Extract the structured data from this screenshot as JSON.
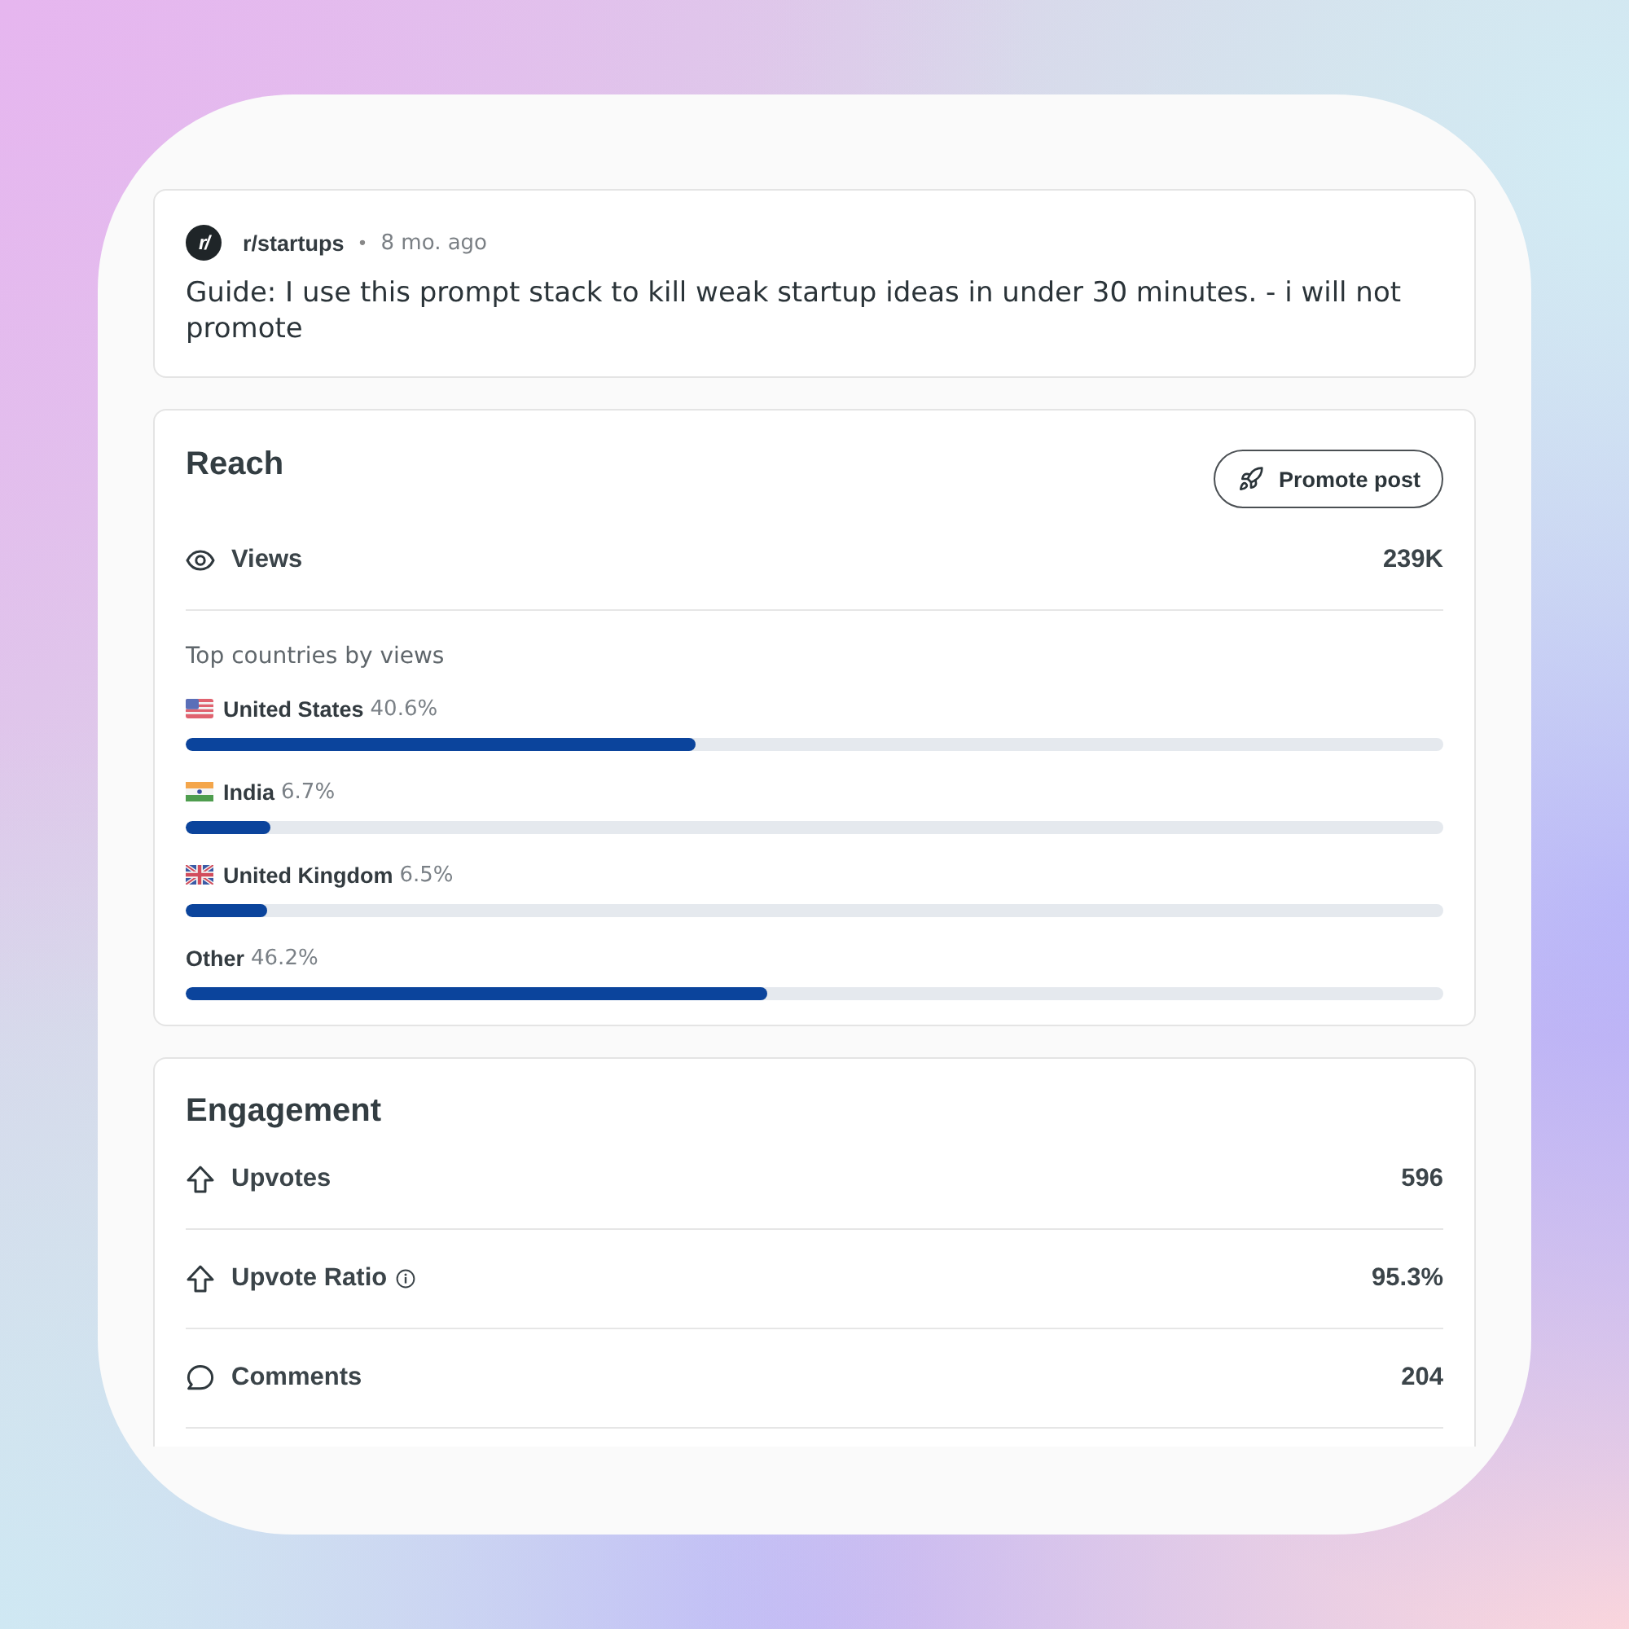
{
  "post": {
    "avatar_text": "r/",
    "subreddit": "r/startups",
    "separator": "•",
    "age": "8 mo. ago",
    "title": "Guide: I use this prompt stack to kill weak startup ideas in under 30 minutes. - i will not promote"
  },
  "reach": {
    "title": "Reach",
    "promote_button": "Promote post",
    "views": {
      "label": "Views",
      "value": "239K"
    },
    "countries_heading": "Top countries by views",
    "countries": [
      {
        "kind": "us",
        "name": "United States",
        "share": "40.6%",
        "level": 0.406
      },
      {
        "kind": "india",
        "name": "India",
        "share": "6.7%",
        "level": 0.067
      },
      {
        "kind": "uk",
        "name": "United Kingdom",
        "share": "6.5%",
        "level": 0.065
      },
      {
        "kind": "plain",
        "name": "Other",
        "share": "46.2%",
        "level": 0.462
      }
    ]
  },
  "engagement": {
    "title": "Engagement",
    "metrics": [
      {
        "kind": "upvote",
        "label": "Upvotes",
        "value": "596",
        "info": false
      },
      {
        "kind": "upvote",
        "label": "Upvote Ratio",
        "value": "95.3%",
        "info": true
      },
      {
        "kind": "comment",
        "label": "Comments",
        "value": "204",
        "info": false
      }
    ]
  }
}
